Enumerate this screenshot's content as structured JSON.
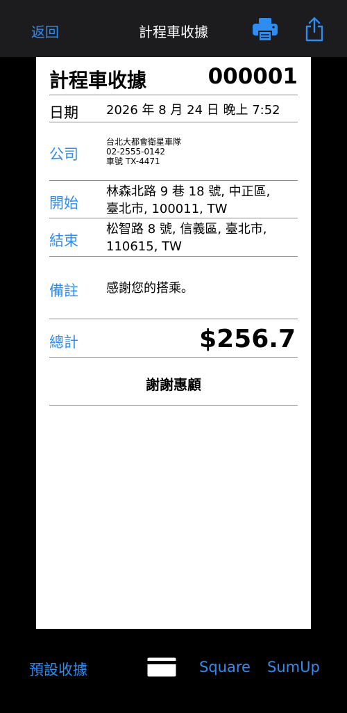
{
  "nav": {
    "back_label": "返回",
    "title": "計程車收據"
  },
  "receipt": {
    "title": "計程車收據",
    "number": "000001",
    "date_label": "日期",
    "date_value": "2026 年 8 月 24 日 晚上 7:52",
    "company_label": "公司",
    "company_lines": [
      "台北大都會衛星車隊",
      "02-2555-0142",
      "車號 TX-4471"
    ],
    "start_label": "開始",
    "start_lines": [
      "林森北路 9 巷 18 號, 中正區,",
      "臺北市, 100011, TW"
    ],
    "end_label": "結束",
    "end_lines": [
      "松智路 8 號, 信義區, 臺北市,",
      "110615, TW"
    ],
    "note_label": "備註",
    "note_value": "感謝您的搭乘。",
    "total_label": "總計",
    "total_value": "$256.7",
    "thanks": "謝謝惠顧"
  },
  "bottom_bar": {
    "preset_label": "預設收據",
    "square_label": "Square",
    "sumup_label": "SumUp"
  },
  "icons": {
    "print": "printer-icon",
    "share": "share-icon",
    "card": "credit-card-icon"
  },
  "colors": {
    "accent": "#2f8cf0",
    "topbar": "#1c1c1e",
    "background": "#000000",
    "paper": "#ffffff"
  }
}
